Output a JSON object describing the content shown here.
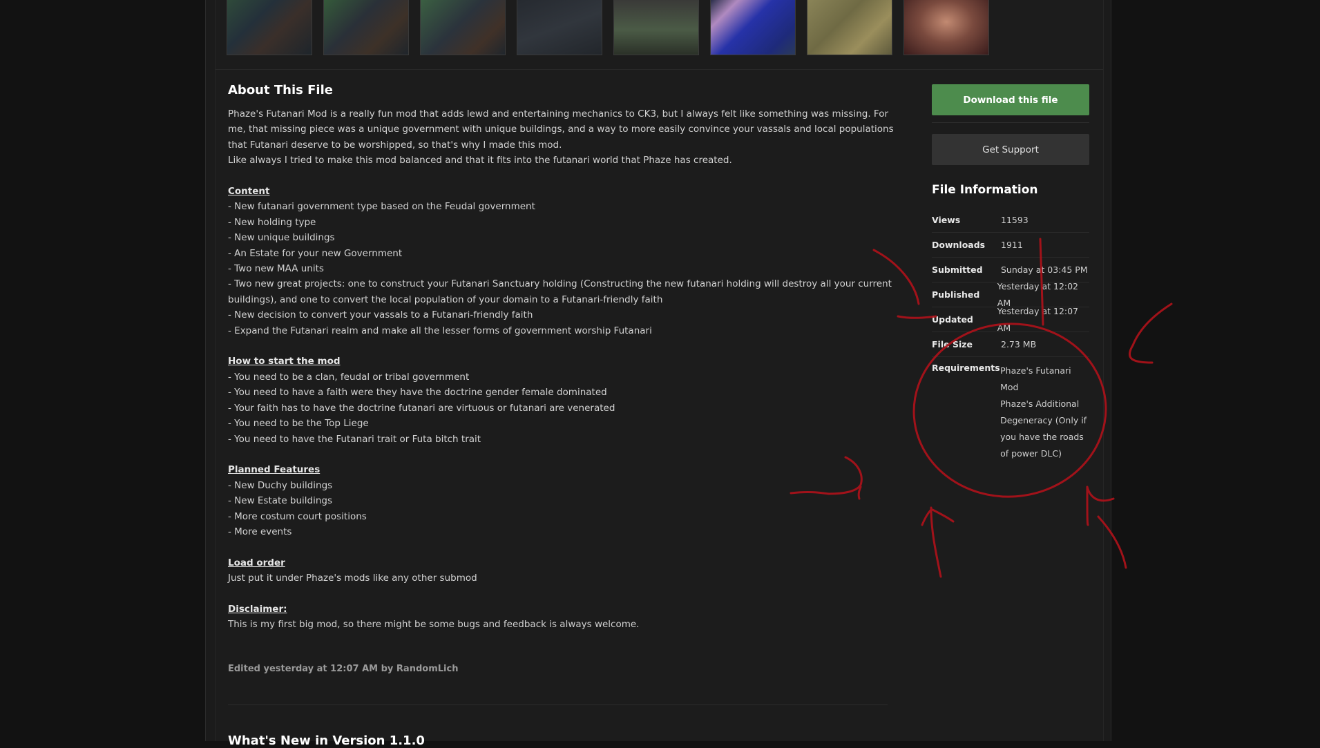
{
  "about": {
    "title": "About This File",
    "intro": [
      "Phaze's Futanari Mod is a really fun mod that adds lewd and entertaining mechanics to CK3, but I always felt like something was missing. For me, that missing piece was a unique government with unique buildings, and a way to more easily convince your vassals and local populations that Futanari deserve to be worshipped,  so that's why I made this mod.",
      "Like always I tried to make this mod balanced and that it fits into the futanari world that Phaze has created."
    ],
    "content_heading": "Content",
    "content_items": [
      "- New futanari government type based on the Feudal government",
      "- New holding type",
      "- New unique buildings",
      "- An Estate for your new Government",
      "- Two new MAA units",
      "- Two new great projects: one to construct your Futanari Sanctuary holding (Constructing the new futanari holding will destroy all your current buildings), and one to convert the local population of your domain to a Futanari-friendly faith",
      "- New decision to convert your vassals to a Futanari-friendly faith",
      "- Expand the Futanari realm and make all the lesser forms of government worship Futanari"
    ],
    "start_heading": "How to start the mod",
    "start_items": [
      "- You need to be a clan, feudal or tribal government",
      "- You need to have a faith were they have the doctrine gender female dominated",
      "- Your faith has to have the doctrine futanari are virtuous or futanari are venerated",
      "- You need to be the Top Liege",
      "- You need to have the Futanari trait or Futa bitch trait"
    ],
    "planned_heading": "Planned Features",
    "planned_items": [
      "- New Duchy buildings",
      "- New Estate buildings",
      "- More costum court positions",
      "- More events"
    ],
    "load_heading": "Load order",
    "load_text": "Just put it under Phaze's mods like any other submod",
    "disclaimer_heading": "Disclaimer:",
    "disclaimer_text": "This is my first big mod, so there might be some bugs and feedback is always welcome.",
    "edited_text": "Edited yesterday at 12:07 AM by",
    "edited_user": "RandomLich",
    "next_heading": "What's New in Version 1.1.0"
  },
  "sidebar": {
    "download_label": "Download this file",
    "support_label": "Get Support",
    "file_info_title": "File Information",
    "views_label": "Views",
    "views_value": "11593",
    "downloads_label": "Downloads",
    "downloads_value": "1911",
    "submitted_label": "Submitted",
    "submitted_value": "Sunday at 03:45 PM",
    "published_label": "Published",
    "published_value": "Yesterday at 12:02 AM",
    "updated_label": "Updated",
    "updated_value": "Yesterday at 12:07 AM",
    "filesize_label": "File Size",
    "filesize_value": "2.73 MB",
    "requirements_label": "Requirements",
    "requirements": [
      "Phaze's Futanari Mod",
      "Phaze's Additional Degeneracy (Only if you have the roads of power DLC)"
    ]
  },
  "colors": {
    "download_button": "#4d8c4d",
    "support_button": "#333333",
    "annotation_ink": "#b0121a"
  }
}
